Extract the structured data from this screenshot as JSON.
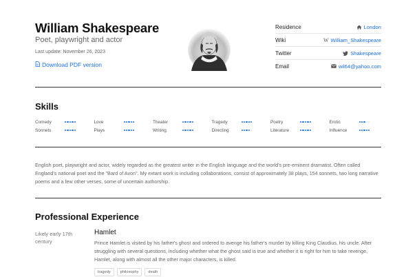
{
  "header": {
    "name": "William Shakespeare",
    "subtitle": "Poet, playwright and actor",
    "last_update": "Last update: November 26, 2023",
    "pdf_link": "Download PDF version",
    "portrait_alt": "portrait"
  },
  "contacts": [
    {
      "label": "Residence",
      "value": "London",
      "icon": "home-icon"
    },
    {
      "label": "Wiki",
      "value": "William_Shakespeare",
      "icon": "wikipedia-icon"
    },
    {
      "label": "Twitter",
      "value": "Shakespeare",
      "icon": "twitter-icon"
    },
    {
      "label": "Email",
      "value": "wil64@yahoo.com",
      "icon": "envelope-icon"
    }
  ],
  "skills": {
    "title": "Skills",
    "items": [
      {
        "name": "Comedy",
        "level": 5
      },
      {
        "name": "Love",
        "level": 5
      },
      {
        "name": "Theater",
        "level": 5
      },
      {
        "name": "Tragedy",
        "level": 5
      },
      {
        "name": "Poetry",
        "level": 5
      },
      {
        "name": "Erotic",
        "level": 3
      },
      {
        "name": "Sonnets",
        "level": 5
      },
      {
        "name": "Plays",
        "level": 5
      },
      {
        "name": "Writing",
        "level": 5
      },
      {
        "name": "Directing",
        "level": 4
      },
      {
        "name": "Literature",
        "level": 5
      },
      {
        "name": "Influence",
        "level": 5
      }
    ]
  },
  "bio": "English poet, playwright and actor, widely regarded as the greatest writer in the English language and the world's pre-eminent dramatist. Often called England's national poet and the \"Bard of Avon\". My extant work is including collaborations, consist of approximately 38 plays, 154 sonnets, two long narrative poems and a few other verses, some of uncertain authorship.",
  "experience": {
    "title": "Professional Experience",
    "jobs": [
      {
        "date": "Likely early 17th century",
        "title": "Hamlet",
        "description": "Prince Hamlet is visited by his father's ghost and ordered to avenge his father's murder by killing King Claudius, his uncle. After struggling with several questions, including whether what the ghost said is true and whether it is right for him to take revenge, Hamlet, along with almost all the other major characters, is killed.",
        "tags": [
          "tragedy",
          "philosophy",
          "death"
        ]
      }
    ]
  },
  "colors": {
    "accent": "#1a6fdb",
    "text": "#222222",
    "muted": "#666666",
    "rule": "#333333"
  }
}
